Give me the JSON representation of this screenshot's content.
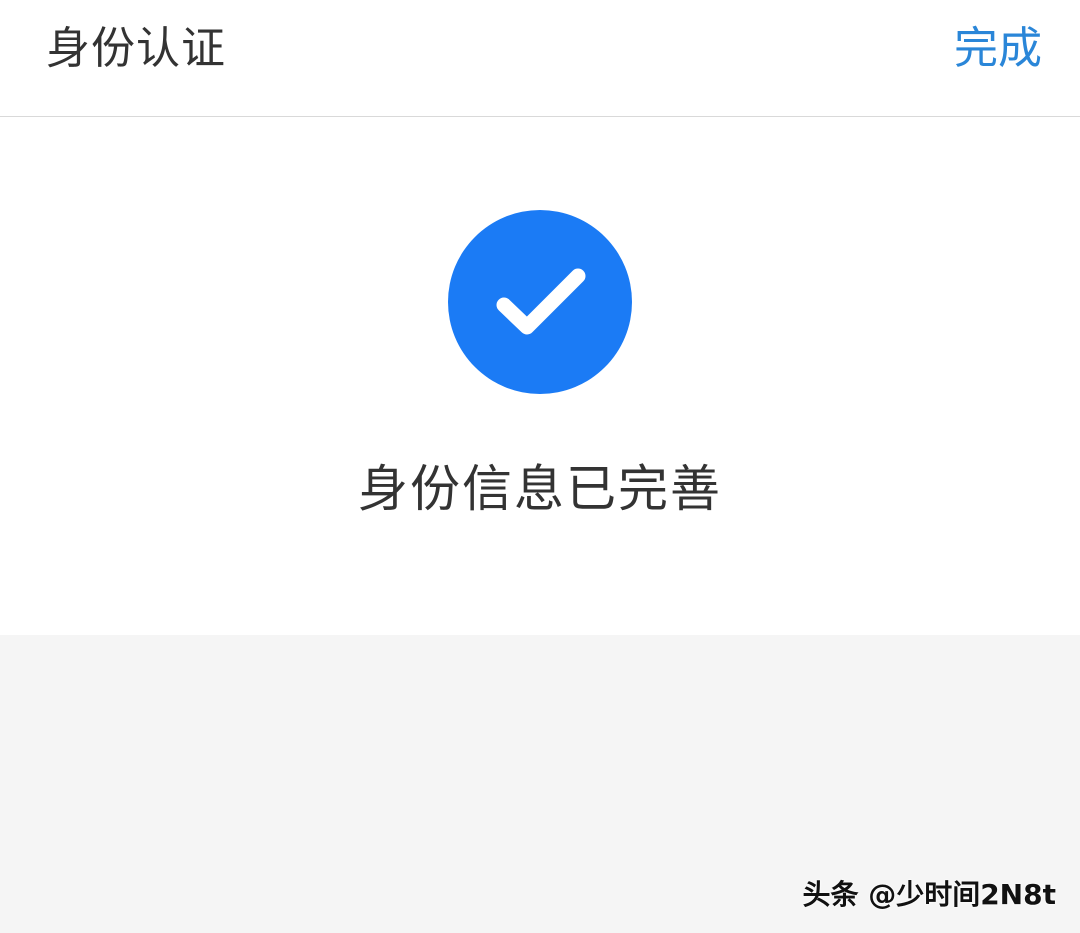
{
  "header": {
    "title": "身份认证",
    "done_label": "完成",
    "done_color": "#2a86d8"
  },
  "status": {
    "icon": "check-circle-icon",
    "icon_color": "#1b7bf5",
    "message": "身份信息已完善"
  },
  "watermark": {
    "text": "头条 @少时间2N8t"
  }
}
